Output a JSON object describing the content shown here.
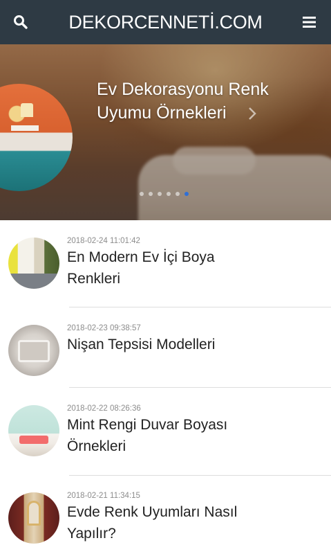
{
  "header": {
    "brand": "DEKORCENNETİ.COM",
    "search_icon": "search-icon",
    "menu_icon": "hamburger-menu-icon",
    "background_color": "#2e3a44"
  },
  "hero": {
    "title": "Ev Dekorasyonu Renk Uyumu Örnekleri",
    "next_icon": "chevron-right-icon",
    "slide_count": 6,
    "active_slide": 6,
    "active_dot_color": "#2f6fd6"
  },
  "articles": [
    {
      "date": "2018-02-24 11:01:42",
      "title": "En Modern Ev İçi Boya Renkleri"
    },
    {
      "date": "2018-02-23 09:38:57",
      "title": "Nişan Tepsisi Modelleri"
    },
    {
      "date": "2018-02-22 08:26:36",
      "title": "Mint Rengi Duvar Boyası Örnekleri"
    },
    {
      "date": "2018-02-21 11:34:15",
      "title": "Evde Renk Uyumları Nasıl Yapılır?"
    }
  ]
}
